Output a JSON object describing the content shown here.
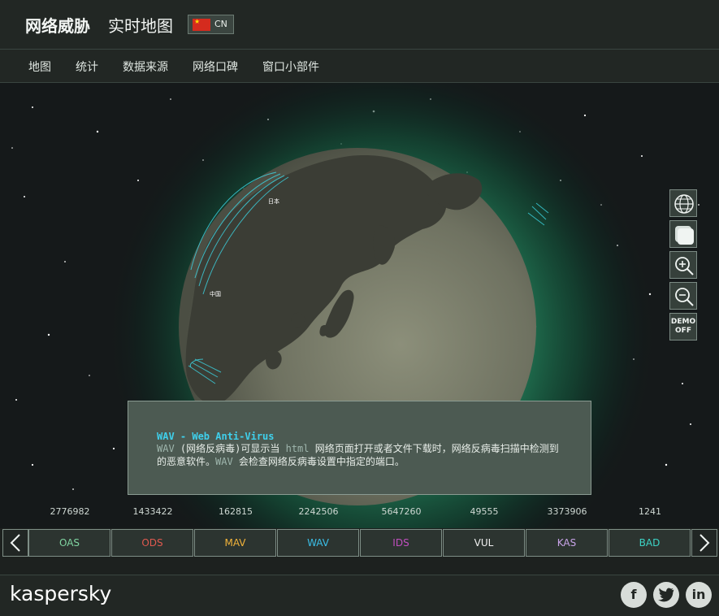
{
  "header": {
    "title_main": "网络威胁",
    "title_sub": "实时地图",
    "lang_code": "CN",
    "flag_icon": "china-flag-icon"
  },
  "nav": {
    "items": [
      "地图",
      "统计",
      "数据来源",
      "网络口碑",
      "窗口小部件"
    ]
  },
  "map": {
    "label_japan": "日本",
    "label_china": "中国"
  },
  "toolbar": {
    "globe_icon": "globe-icon",
    "flat_icon": "flat-map-icon",
    "zoom_in_icon": "zoom-in-icon",
    "zoom_out_icon": "zoom-out-icon",
    "demo_line1": "DEMO",
    "demo_line2": "OFF"
  },
  "info": {
    "title": "WAV - Web Anti-Virus",
    "text_prefix": "WAV",
    "text_body": " (网络反病毒)可显示当 ",
    "text_html": "html",
    "text_body2": " 网络页面打开或者文件下载时，网络反病毒扫描中检测到的恶意软件。",
    "text_wav2": "WAV",
    "text_body3": " 会检查网络反病毒设置中指定的端口。"
  },
  "stats": {
    "values": [
      "2776982",
      "1433422",
      "162815",
      "2242506",
      "5647260",
      "49555",
      "3373906",
      "1241"
    ]
  },
  "tabs": {
    "labels": [
      "OAS",
      "ODS",
      "MAV",
      "WAV",
      "IDS",
      "VUL",
      "KAS",
      "BAD"
    ],
    "colors": [
      "#7fd4a1",
      "#e0594f",
      "#f2b33a",
      "#3bbfe8",
      "#c14fbf",
      "#f2f2f2",
      "#c8a3e8",
      "#3cd3c6"
    ],
    "left_arrow_icon": "chevron-left-icon",
    "right_arrow_icon": "chevron-right-icon"
  },
  "footer": {
    "logo": "kaspersky",
    "social": [
      "f",
      "t",
      "in"
    ]
  }
}
